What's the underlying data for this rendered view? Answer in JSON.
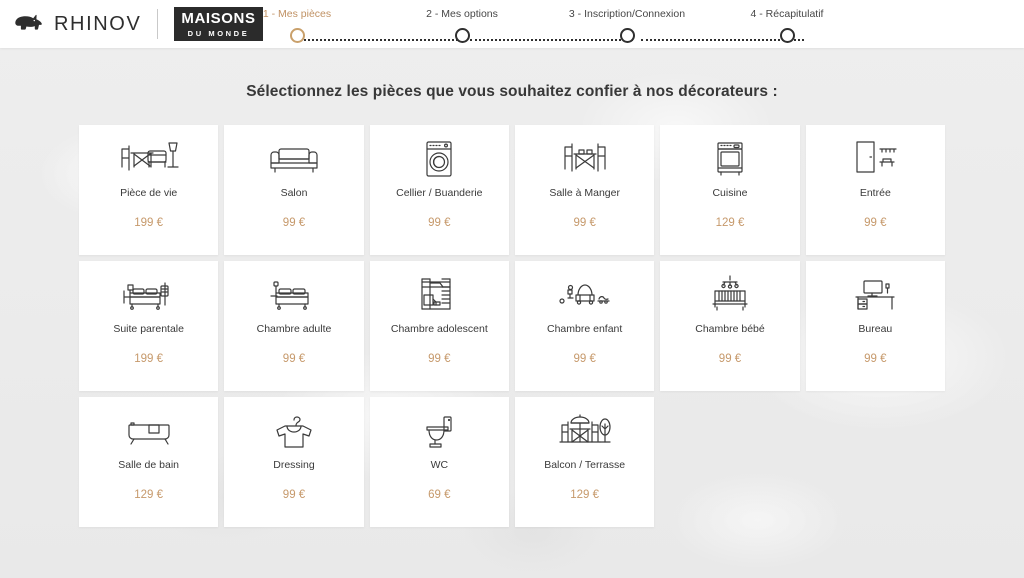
{
  "header": {
    "brand_name": "RHINOV",
    "rhino_icon": "rhino-icon",
    "partner_logo_line1": "MAISONS",
    "partner_logo_line2": "DU MONDE",
    "steps": [
      {
        "label": "1 - Mes pièces",
        "active": true
      },
      {
        "label": "2 - Mes options",
        "active": false
      },
      {
        "label": "3 - Inscription/Connexion",
        "active": false
      },
      {
        "label": "4 - Récapitulatif",
        "active": false
      }
    ]
  },
  "main": {
    "title": "Sélectionnez les pièces que vous souhaitez confier à nos décorateurs :",
    "rooms": [
      {
        "label": "Pièce de vie",
        "price": "199 €",
        "icon": "living-room-icon"
      },
      {
        "label": "Salon",
        "price": "99 €",
        "icon": "sofa-icon"
      },
      {
        "label": "Cellier / Buanderie",
        "price": "99 €",
        "icon": "washing-machine-icon"
      },
      {
        "label": "Salle à Manger",
        "price": "99 €",
        "icon": "dining-table-icon"
      },
      {
        "label": "Cuisine",
        "price": "129 €",
        "icon": "oven-icon"
      },
      {
        "label": "Entrée",
        "price": "99 €",
        "icon": "entrance-icon"
      },
      {
        "label": "Suite parentale",
        "price": "199 €",
        "icon": "master-bed-icon"
      },
      {
        "label": "Chambre adulte",
        "price": "99 €",
        "icon": "double-bed-icon"
      },
      {
        "label": "Chambre adolescent",
        "price": "99 €",
        "icon": "bunk-bed-icon"
      },
      {
        "label": "Chambre enfant",
        "price": "99 €",
        "icon": "toy-car-icon"
      },
      {
        "label": "Chambre bébé",
        "price": "99 €",
        "icon": "crib-icon"
      },
      {
        "label": "Bureau",
        "price": "99 €",
        "icon": "desk-icon"
      },
      {
        "label": "Salle de bain",
        "price": "129 €",
        "icon": "bathtub-icon"
      },
      {
        "label": "Dressing",
        "price": "99 €",
        "icon": "tshirt-hanger-icon"
      },
      {
        "label": "WC",
        "price": "69 €",
        "icon": "toilet-icon"
      },
      {
        "label": "Balcon / Terrasse",
        "price": "129 €",
        "icon": "parasol-table-icon"
      }
    ]
  },
  "colors": {
    "accent": "#c6996b",
    "active_step": "#c09163",
    "text": "#3a3a3a",
    "card_bg": "#ffffff",
    "page_bg": "#ececec",
    "logo_bg": "#2b2b2b"
  }
}
